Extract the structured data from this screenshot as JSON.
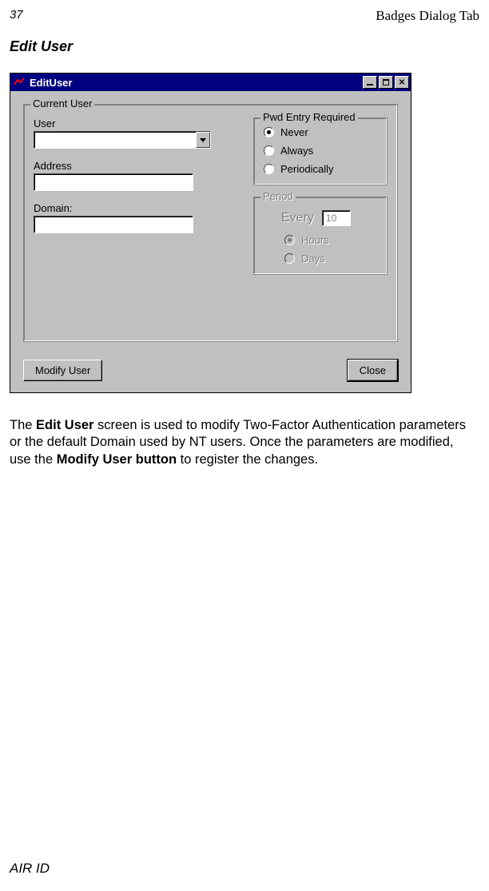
{
  "page": {
    "number": "37",
    "header_title": "Badges Dialog Tab",
    "section_title": "Edit User",
    "footer": "AIR ID"
  },
  "window": {
    "title": "EditUser",
    "icon_name": "app-icon"
  },
  "current_user": {
    "legend": "Current User",
    "user_label": "User",
    "user_value": "",
    "address_label": "Address",
    "address_value": "",
    "domain_label": "Domain:",
    "domain_value": ""
  },
  "pwd_entry": {
    "legend": "Pwd Entry Required",
    "options": {
      "never": "Never",
      "always": "Always",
      "periodically": "Periodically"
    },
    "selected": "never"
  },
  "period": {
    "legend": "Period",
    "every_label": "Every",
    "every_value": "10",
    "options": {
      "hours": "Hours",
      "days": "Days"
    },
    "selected": "hours"
  },
  "buttons": {
    "modify": "Modify User",
    "close": "Close"
  },
  "body_text": {
    "p1a": "The ",
    "p1b": "Edit User",
    "p1c": " screen is used to modify Two-Factor Authentication parameters or the default Domain used by NT users. Once the parameters are modified, use the ",
    "p1d": "Modify User button",
    "p1e": " to register the changes."
  }
}
